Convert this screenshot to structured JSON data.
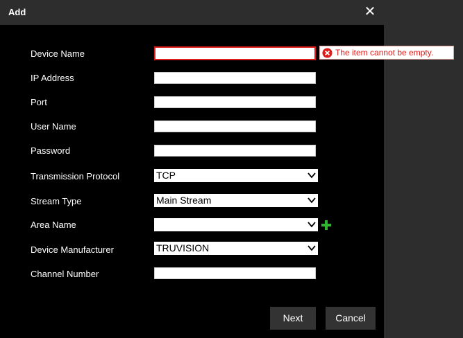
{
  "dialog": {
    "title": "Add",
    "close_icon": "close-icon"
  },
  "fields": {
    "device_name": {
      "label": "Device Name",
      "value": ""
    },
    "ip_address": {
      "label": "IP Address",
      "value": ""
    },
    "port": {
      "label": "Port",
      "value": ""
    },
    "user_name": {
      "label": "User Name",
      "value": ""
    },
    "password": {
      "label": "Password",
      "value": ""
    },
    "transmission_protocol": {
      "label": "Transmission Protocol",
      "value": "TCP"
    },
    "stream_type": {
      "label": "Stream Type",
      "value": "Main Stream"
    },
    "area_name": {
      "label": "Area Name",
      "value": ""
    },
    "device_manufacturer": {
      "label": "Device Manufacturer",
      "value": "TRUVISION"
    },
    "channel_number": {
      "label": "Channel Number",
      "value": ""
    }
  },
  "error": {
    "message": "The item cannot be empty."
  },
  "buttons": {
    "next": "Next",
    "cancel": "Cancel"
  },
  "colors": {
    "error": "#e01b1b",
    "add": "#2fb52f",
    "titlebar": "#2d2d2d"
  }
}
